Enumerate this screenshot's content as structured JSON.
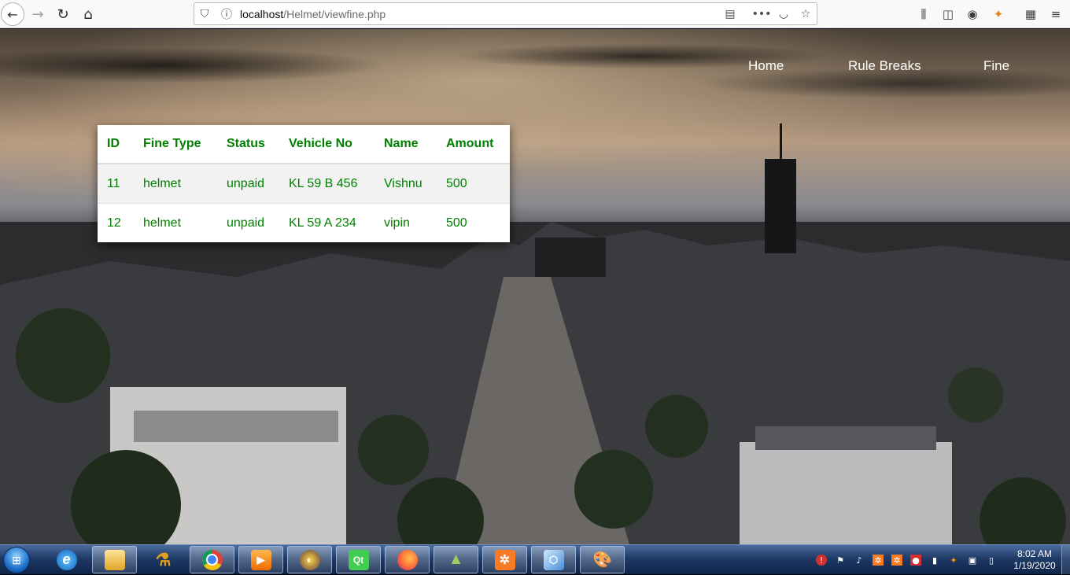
{
  "browser": {
    "url_host": "localhost",
    "url_path": "/Helmet/viewfine.php"
  },
  "nav": {
    "home": "Home",
    "rule_breaks": "Rule Breaks",
    "fine": "Fine"
  },
  "fines_table": {
    "headers": [
      "ID",
      "Fine Type",
      "Status",
      "Vehicle No",
      "Name",
      "Amount"
    ],
    "rows": [
      [
        "11",
        "helmet",
        "unpaid",
        "KL 59 B 456",
        "Vishnu",
        "500"
      ],
      [
        "12",
        "helmet",
        "unpaid",
        "KL 59 A 234",
        "vipin",
        "500"
      ]
    ]
  },
  "taskbar": {
    "apps": [
      "internet-explorer",
      "file-explorer",
      "app-launcher",
      "chrome",
      "media-player",
      "app-player",
      "qt-creator",
      "firefox",
      "android-studio",
      "xampp",
      "virtualbox",
      "paint"
    ],
    "active_app": "firefox",
    "time": "8:02 AM",
    "date": "1/19/2020"
  },
  "colors": {
    "table_text": "#008000",
    "nav_text": "#ffffff",
    "taskbar": "#1f3a66"
  }
}
